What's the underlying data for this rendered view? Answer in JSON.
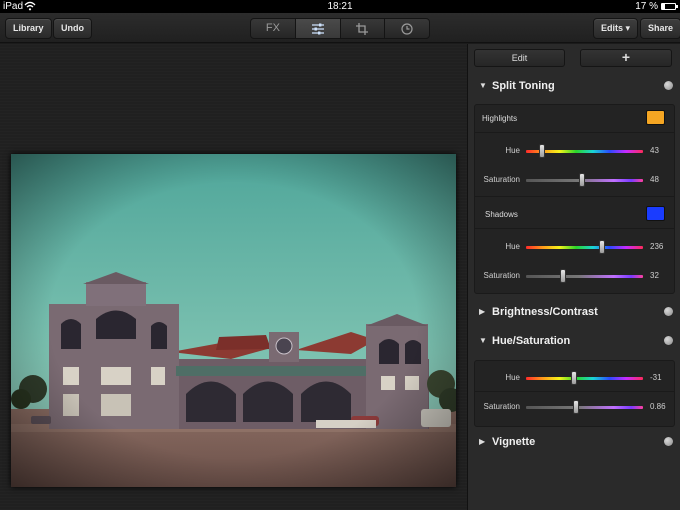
{
  "status_bar": {
    "carrier": "iPad",
    "time": "18:21",
    "battery": "17 %"
  },
  "toolbar": {
    "library_label": "Library",
    "undo_label": "Undo",
    "tabs": [
      "FX",
      "adjust-sliders-icon",
      "crop-icon",
      "history-clock-icon"
    ],
    "fx_label": "FX",
    "active_tab": "adjust",
    "edits_label": "Edits ▾",
    "share_label": "Share"
  },
  "panel": {
    "edit_label": "Edit",
    "add_label": "+",
    "split_toning": {
      "title": "Split Toning",
      "expanded": true,
      "highlights": {
        "title": "Highlights",
        "color": "#f5a623",
        "hue_label": "Hue",
        "hue_value": "43",
        "hue_fraction": 0.14,
        "sat_label": "Saturation",
        "sat_value": "48",
        "sat_fraction": 0.48
      },
      "shadows": {
        "title": "Shadows",
        "color": "#1a3cff",
        "hue_label": "Hue",
        "hue_value": "236",
        "hue_fraction": 0.65,
        "sat_label": "Saturation",
        "sat_value": "32",
        "sat_fraction": 0.32
      }
    },
    "brightness_contrast": {
      "title": "Brightness/Contrast",
      "expanded": false
    },
    "hue_saturation": {
      "title": "Hue/Saturation",
      "expanded": true,
      "hue_label": "Hue",
      "hue_value": "-31",
      "hue_fraction": 0.41,
      "sat_label": "Saturation",
      "sat_value": "0.86",
      "sat_fraction": 0.43
    },
    "vignette": {
      "title": "Vignette",
      "expanded": false
    }
  }
}
